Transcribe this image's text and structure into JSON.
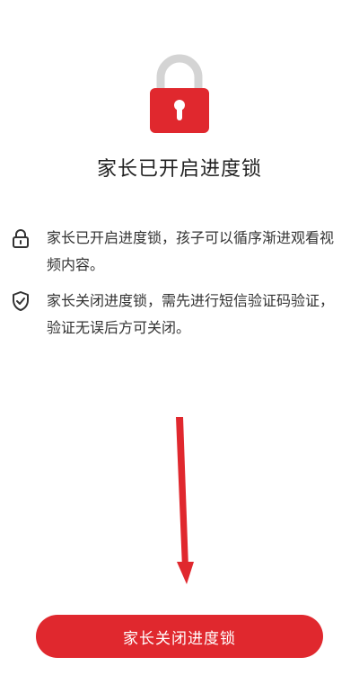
{
  "title": "家长已开启进度锁",
  "info_items": [
    {
      "icon": "lock-icon",
      "text": "家长已开启进度锁，孩子可以循序渐进观看视频内容。"
    },
    {
      "icon": "shield-check-icon",
      "text": "家长关闭进度锁，需先进行短信验证码验证，验证无误后方可关闭。"
    }
  ],
  "primary_button": {
    "label": "家长关闭进度锁"
  },
  "colors": {
    "accent": "#e0282e",
    "lock_shackle": "#d4d4d4"
  }
}
